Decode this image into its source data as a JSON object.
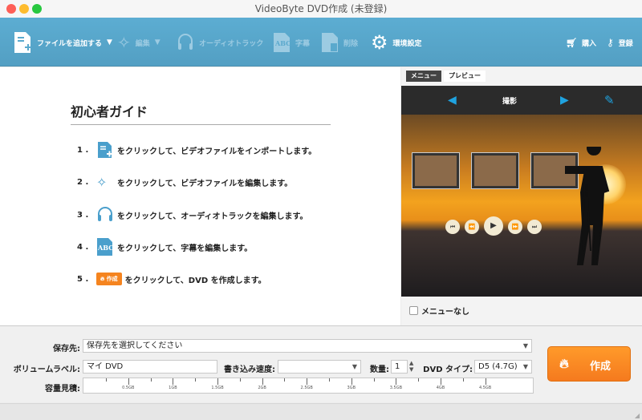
{
  "window": {
    "title": "VideoByte DVD作成 (未登録)"
  },
  "toolbar": {
    "add_file": "ファイルを追加する",
    "edit": "編集",
    "audio_track": "オーディオトラック",
    "subtitle": "字幕",
    "delete": "削除",
    "settings": "環境設定",
    "buy": "購入",
    "register": "登録"
  },
  "guide": {
    "title": "初心者ガイド",
    "steps": [
      {
        "num": "1 .",
        "text": "をクリックして、ビデオファイルをインポートします。",
        "icon": "add-file-icon"
      },
      {
        "num": "2 .",
        "text": "をクリックして、ビデオファイルを編集します。",
        "icon": "magic-wand-icon"
      },
      {
        "num": "3 .",
        "text": "をクリックして、オーディオトラックを編集します。",
        "icon": "headphones-icon"
      },
      {
        "num": "4 .",
        "text": "をクリックして、字幕を編集します。",
        "icon": "subtitle-abc-icon"
      },
      {
        "num": "5 .",
        "text": "をクリックして、DVD を作成します。",
        "icon": "create-button-icon",
        "button_label": "作成"
      }
    ]
  },
  "menu_panel": {
    "tabs": [
      "メニュー",
      "プレビュー"
    ],
    "active_tab": "メニュー",
    "template_name": "撮影",
    "no_menu_label": "メニューなし",
    "no_menu_checked": false
  },
  "output": {
    "dest_label": "保存先:",
    "dest_value": "保存先を選択してください",
    "volume_label": "ボリュームラベル:",
    "volume_value": "マイ DVD",
    "speed_label": "書き込み速度:",
    "speed_value": "",
    "count_label": "数量:",
    "count_value": "1",
    "dvd_type_label": "DVD タイプ:",
    "dvd_type_value": "D5 (4.7G)",
    "capacity_label": "容量見積:",
    "capacity_ticks": [
      "0.5GB",
      "1GB",
      "1.5GB",
      "2GB",
      "2.5GB",
      "3GB",
      "3.5GB",
      "4GB",
      "4.5GB"
    ],
    "capacity_used": 0,
    "create_label": "作成"
  },
  "colors": {
    "toolbar": "#5aa9cd",
    "accent": "#f5841f",
    "icon_blue": "#4a9fcc"
  }
}
